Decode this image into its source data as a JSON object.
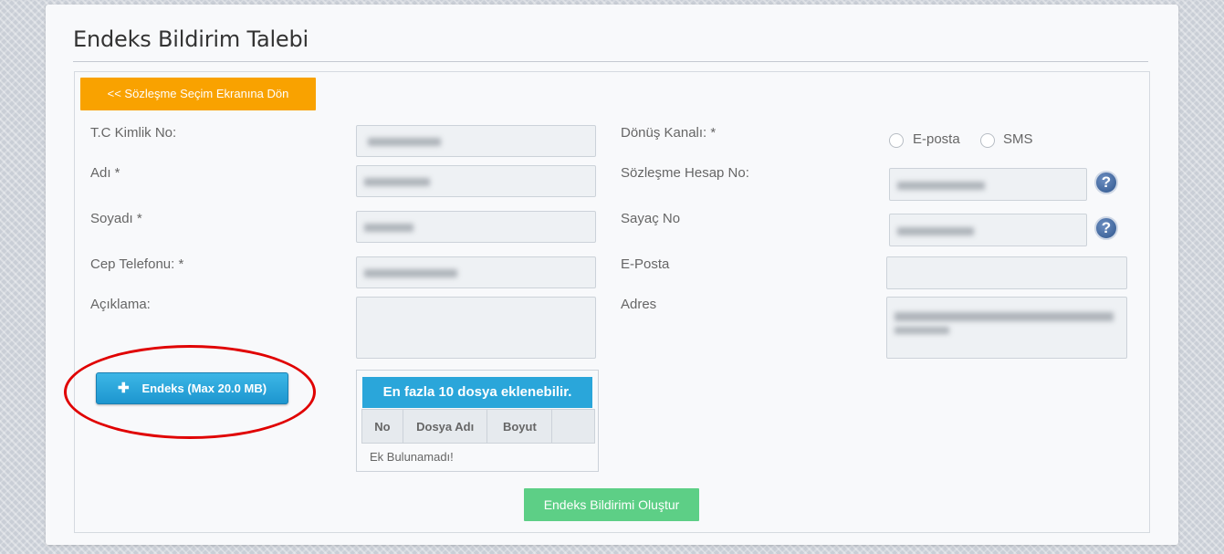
{
  "page": {
    "title": "Endeks Bildirim Talebi"
  },
  "back_button": {
    "label": "<< Sözleşme Seçim Ekranına Dön"
  },
  "form": {
    "tc_label": "T.C Kimlik No:",
    "name_label": "Adı *",
    "surname_label": "Soyadı *",
    "phone_label": "Cep Telefonu: *",
    "description_label": "Açıklama:",
    "return_channel_label": "Dönüş Kanalı: *",
    "radio_email": "E-posta",
    "radio_sms": "SMS",
    "contract_label": "Sözleşme Hesap No:",
    "meter_label": "Sayaç No",
    "email_label": "E-Posta",
    "address_label": "Adres"
  },
  "upload": {
    "button_label": "Endeks (Max 20.0 MB)",
    "icon": "plus-icon",
    "limit_text": "En fazla 10 dosya eklenebilir.",
    "columns": [
      "No",
      "Dosya Adı",
      "Boyut",
      ""
    ],
    "empty_text": "Ek Bulunamadı!"
  },
  "submit": {
    "label": "Endeks Bildirimi Oluştur"
  },
  "help_icon": "?",
  "colors": {
    "back_button": "#f9a200",
    "upload_button": "#1d96cf",
    "submit_button": "#5dcf86",
    "annotation_circle": "#e00000"
  }
}
